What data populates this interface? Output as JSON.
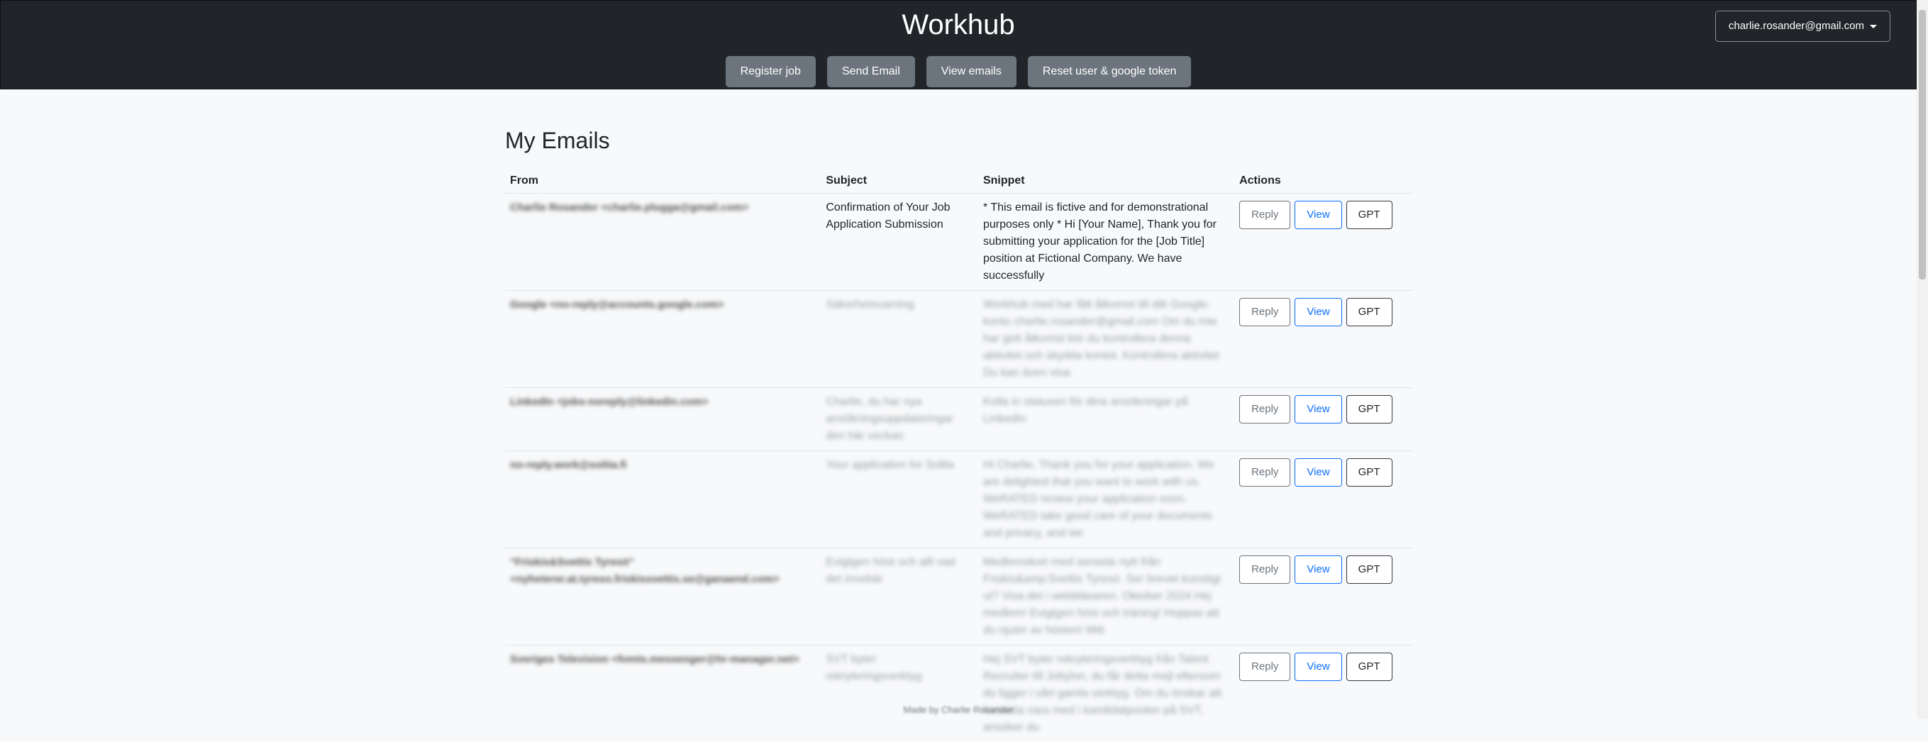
{
  "header": {
    "title": "Workhub",
    "account_label": "charlie.rosander@gmail.com",
    "buttons": [
      "Register job",
      "Send Email",
      "View emails",
      "Reset user & google token"
    ]
  },
  "page": {
    "title": "My Emails"
  },
  "table": {
    "headers": [
      "From",
      "Subject",
      "Snippet",
      "Actions"
    ],
    "action_labels": {
      "reply": "Reply",
      "view": "View",
      "gpt": "GPT"
    },
    "rows": [
      {
        "from": "Charlie Rosander <charlie.plugga@gmail.com>",
        "subject": "Confirmation of Your Job Application Submission",
        "snippet": "* This email is fictive and for demonstrational purposes only * Hi [Your Name], Thank you for submitting your application for the [Job Title] position at Fictional Company. We have successfully"
      },
      {
        "from": "Google <no-reply@accounts.google.com>",
        "subject": "Säkerhetsvarning",
        "snippet": "Workhub med har fått åtkomst till ditt Google-konto charlie.rosander@gmail.com Om du inte har gett åtkomst bör du kontrollera denna aktivitet och skydda kontot. Kontrollera aktivitet Du kan även visa"
      },
      {
        "from": "LinkedIn <jobs-noreply@linkedin.com>",
        "subject": "Charlie, du har nya ansökningsuppdateringar den här veckan",
        "snippet": "Kolla in statusen för dina ansökningar på LinkedIn"
      },
      {
        "from": "no-reply.work@solita.fi",
        "subject": "Your application for Solita",
        "snippet": "Hi Charlie, Thank you for your application. We are delighted that you want to work with us. WeRATED review your application soon. WeRATED take good care of your documents and privacy, and we"
      },
      {
        "from": "\"Friskis&Svettis Tyresö\" <nyheterer.at.tyreso.friskissvettis.se@ganaend.com>",
        "subject": "Evigtgen höst och allt vad det innebär",
        "snippet": "Medlemskort med senaste nytt från Friskis&amp;Svettis Tyresö. Ser brevet konstigt ut? Visa det i webbläsaren. Oktober 2024 Hej medlem! Evigtgen höst och träning! Hoppas att du njuter av hösten! Mitt"
      },
      {
        "from": "Sveriges Television <fomts.messenger@hr-manager.net>",
        "subject": "SVT byter rekryteringsverktyg",
        "snippet": "Hej SVT byter rekryteringsverktyg från Talent Recruiter till Jobylon, du får detta mejl eftersom du ligger i vårt gamla verktyg. Om du önskar att fortsätta vara med i kandidatpoolen på SVT, ansöker du"
      }
    ]
  },
  "footer": {
    "text": "Made by Charlie Rosander"
  }
}
